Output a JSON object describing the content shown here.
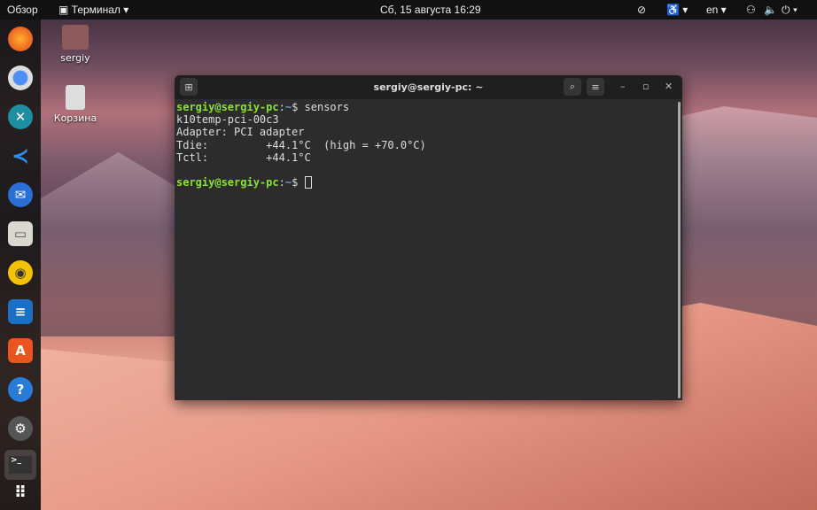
{
  "topbar": {
    "overview": "Обзор",
    "app": "Терминал ▾",
    "datetime": "Сб, 15 августа  16:29",
    "lang": "en ▾"
  },
  "desktop": [
    {
      "label": "sergiy"
    },
    {
      "label": "Корзина"
    }
  ],
  "dock": [
    "firefox",
    "chromium",
    "remmina",
    "vscode",
    "thunderbird",
    "files",
    "rhythmbox",
    "writer",
    "software",
    "help",
    "settings",
    "terminal",
    "apps"
  ],
  "terminal": {
    "title": "sergiy@sergiy-pc: ~",
    "prompt_user": "sergiy@sergiy-pc",
    "prompt_path": "~",
    "prompt_sym": "$ ",
    "command": "sensors",
    "lines": [
      "k10temp-pci-00c3",
      "Adapter: PCI adapter",
      "Tdie:         +44.1°C  (high = +70.0°C)",
      "Tctl:         +44.1°C"
    ]
  },
  "colors": {
    "prompt": "#8ae234",
    "path": "#729fcf"
  }
}
